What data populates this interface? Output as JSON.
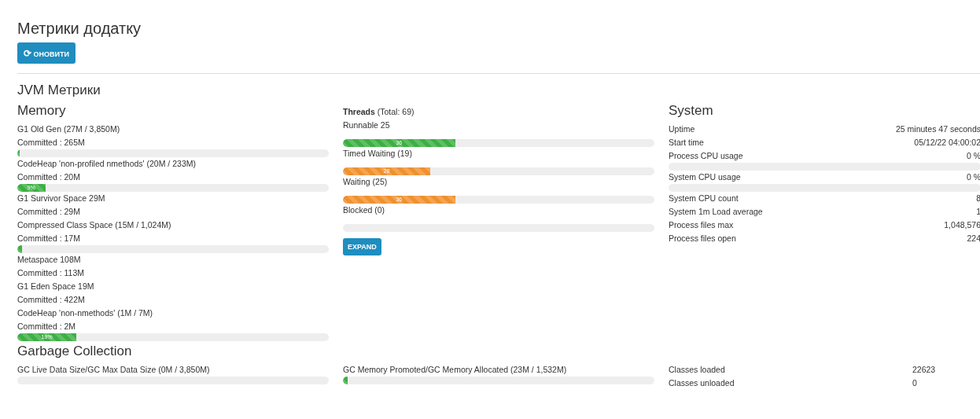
{
  "title": "Метрики додатку",
  "refresh_button": {
    "icon": "⟳",
    "label": "ОНОВИТИ"
  },
  "section_title": "JVM Метрики",
  "memory": {
    "title": "Memory",
    "items": [
      {
        "name": "G1 Old Gen (27M / 3,850M)",
        "committed": "Committed : 265M",
        "level": 0.007,
        "color": "#3cb043"
      },
      {
        "name": "CodeHeap 'non-profiled nmethods' (20M / 233M)",
        "committed": "Committed : 20M",
        "level": 0.09,
        "bar_label": "9%",
        "color": "#3cb043"
      },
      {
        "name": "G1 Survivor Space 29M",
        "committed": "Committed : 29M"
      },
      {
        "name": "Compressed Class Space (15M / 1,024M)",
        "committed": "Committed : 17M",
        "level": 0.015,
        "color": "#3cb043"
      },
      {
        "name": "Metaspace 108M",
        "committed": "Committed : 113M"
      },
      {
        "name": "G1 Eden Space 19M",
        "committed": "Committed : 422M"
      },
      {
        "name": "CodeHeap 'non-nmethods' (1M / 7M)",
        "committed": "Committed : 2M",
        "level": 0.19,
        "bar_label": "19%",
        "color": "#3cb043"
      }
    ]
  },
  "threads": {
    "title": "Threads",
    "total": "(Total: 69)",
    "items": [
      {
        "label": "Runnable 25",
        "level": 0.36,
        "bar_label": "36",
        "color": "#3cb043"
      },
      {
        "label": "Timed Waiting (19)",
        "level": 0.28,
        "bar_label": "28",
        "color": "#f0902e"
      },
      {
        "label": "Waiting (25)",
        "level": 0.36,
        "bar_label": "36",
        "color": "#f0902e"
      },
      {
        "label": "Blocked (0)"
      }
    ],
    "expand_button": "EXPAND"
  },
  "system": {
    "title": "System",
    "rows": [
      {
        "kind": "text",
        "label": "Uptime",
        "value": "25 minutes 47 seconds"
      },
      {
        "kind": "text",
        "label": "Start time",
        "value": "05/12/22 04:00:02"
      },
      {
        "kind": "meter",
        "label": "Process CPU usage",
        "value": "0 %"
      },
      {
        "kind": "meter",
        "label": "System CPU usage",
        "value": "0 %"
      },
      {
        "kind": "text",
        "label": "System CPU count",
        "value": "8"
      },
      {
        "kind": "text",
        "label": "System 1m Load average",
        "value": "1"
      },
      {
        "kind": "text",
        "label": "Process files max",
        "value": "1,048,576"
      },
      {
        "kind": "text",
        "label": "Process files open",
        "value": "224"
      }
    ]
  },
  "garbage_collection": {
    "title": "Garbage Collection",
    "bars": [
      {
        "label": "GC Live Data Size/GC Max Data Size (0M / 3,850M)"
      },
      {
        "label": "GC Memory Promoted/GC Memory Allocated (23M / 1,532M)",
        "level": 0.015,
        "color": "#3cb043"
      }
    ],
    "classes": [
      {
        "label": "Classes loaded",
        "value": "22623"
      },
      {
        "label": "Classes unloaded",
        "value": "0"
      }
    ]
  }
}
